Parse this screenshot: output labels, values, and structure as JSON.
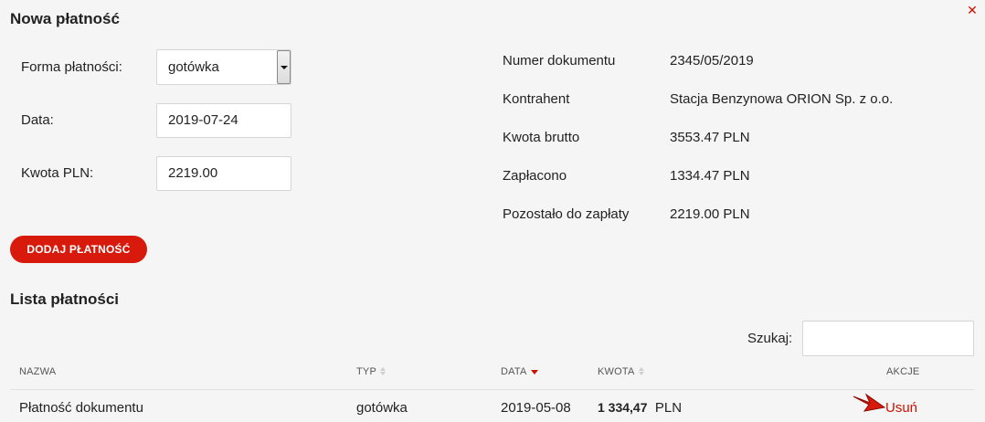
{
  "dialog": {
    "title": "Nowa płatność",
    "close_icon": "close-icon"
  },
  "form": {
    "payment_method_label": "Forma płatności:",
    "payment_method_value": "gotówka",
    "date_label": "Data:",
    "date_value": "2019-07-24",
    "amount_label": "Kwota PLN:",
    "amount_value": "2219.00",
    "add_button_label": "DODAJ PŁATNOŚĆ"
  },
  "document_info": [
    {
      "label": "Numer dokumentu",
      "value": "2345/05/2019"
    },
    {
      "label": "Kontrahent",
      "value": "Stacja Benzynowa ORION Sp. z o.o."
    },
    {
      "label": "Kwota brutto",
      "value": "3553.47 PLN"
    },
    {
      "label": "Zapłacono",
      "value": "1334.47 PLN"
    },
    {
      "label": "Pozostało do zapłaty",
      "value": "2219.00 PLN"
    }
  ],
  "payments_list": {
    "title": "Lista płatności",
    "search_label": "Szukaj:",
    "search_value": "",
    "columns": [
      "NAZWA",
      "TYP",
      "DATA",
      "KWOTA",
      "AKCJE"
    ],
    "rows": [
      {
        "name": "Płatność dokumentu",
        "type": "gotówka",
        "date": "2019-05-08",
        "amount": "1 334,47",
        "currency": "PLN",
        "action": "Usuń"
      }
    ]
  },
  "colors": {
    "accent": "#d71a0b",
    "link": "#cc1100",
    "background": "#f5f5f5"
  }
}
